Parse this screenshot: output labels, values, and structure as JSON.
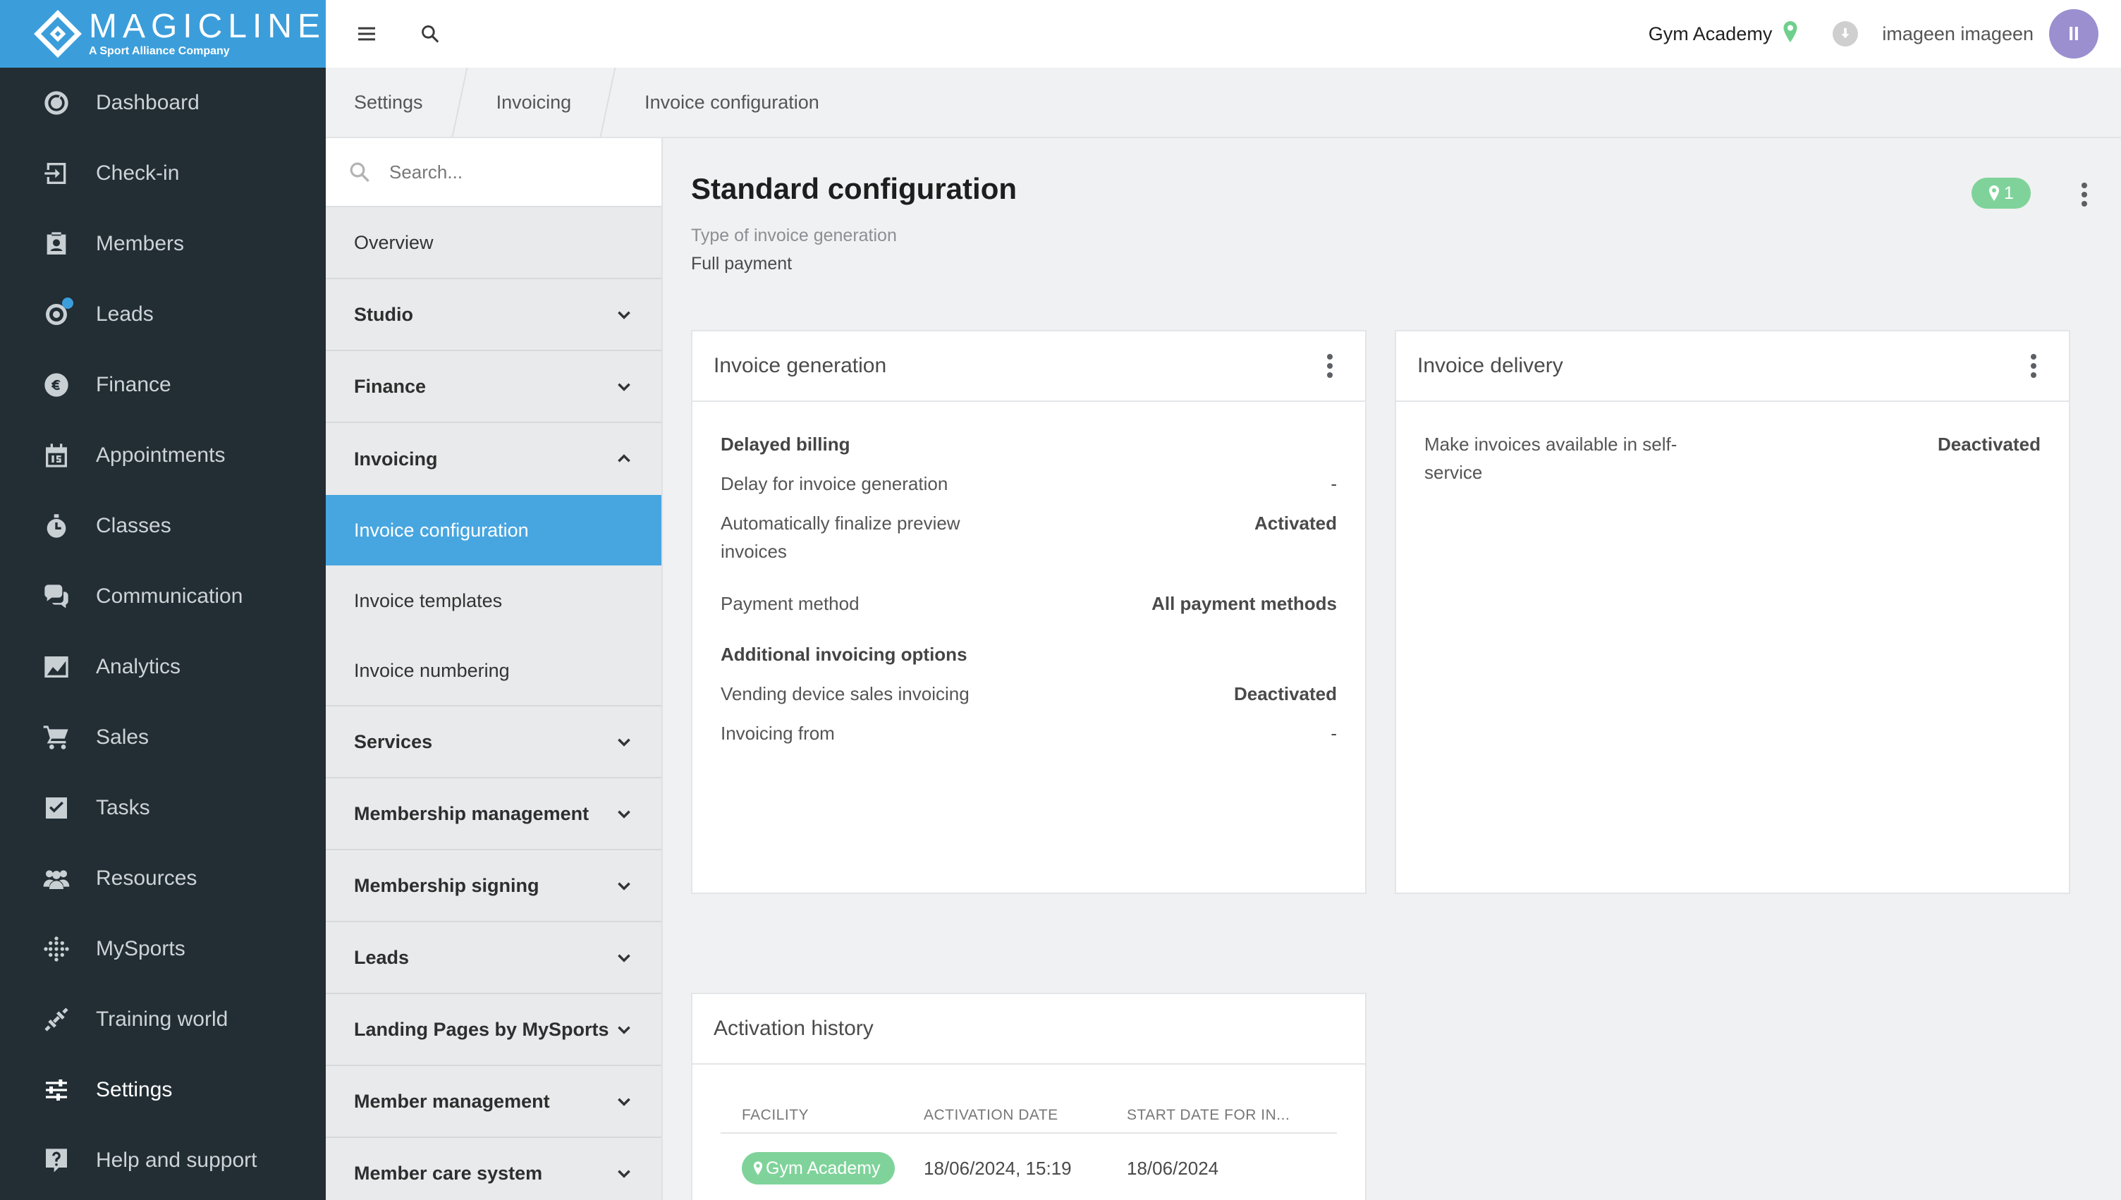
{
  "brand": {
    "name": "MAGICLINE",
    "tagline": "A Sport Alliance Company"
  },
  "nav": {
    "items": [
      {
        "label": "Dashboard",
        "icon": "dashboard-icon"
      },
      {
        "label": "Check-in",
        "icon": "check-in-icon"
      },
      {
        "label": "Members",
        "icon": "members-icon"
      },
      {
        "label": "Leads",
        "icon": "leads-icon"
      },
      {
        "label": "Finance",
        "icon": "euro-icon"
      },
      {
        "label": "Appointments",
        "icon": "calendar-icon"
      },
      {
        "label": "Classes",
        "icon": "stopwatch-icon"
      },
      {
        "label": "Communication",
        "icon": "chat-icon"
      },
      {
        "label": "Analytics",
        "icon": "chart-icon"
      },
      {
        "label": "Sales",
        "icon": "cart-icon"
      },
      {
        "label": "Tasks",
        "icon": "checkbox-icon"
      },
      {
        "label": "Resources",
        "icon": "people-icon"
      },
      {
        "label": "MySports",
        "icon": "dots-grid-icon"
      },
      {
        "label": "Training world",
        "icon": "dumbbell-icon"
      },
      {
        "label": "Settings",
        "icon": "sliders-icon"
      },
      {
        "label": "Help and support",
        "icon": "help-icon"
      }
    ]
  },
  "topbar": {
    "studio": "Gym Academy",
    "user": "imageen imageen",
    "avatar_initials": "II"
  },
  "breadcrumb": [
    "Settings",
    "Invoicing",
    "Invoice configuration"
  ],
  "subnav": {
    "search_placeholder": "Search...",
    "overview": "Overview",
    "studio": "Studio",
    "finance": "Finance",
    "invoicing": "Invoicing",
    "invoice_configuration": "Invoice configuration",
    "invoice_templates": "Invoice templates",
    "invoice_numbering": "Invoice numbering",
    "services": "Services",
    "membership_management": "Membership management",
    "membership_signing": "Membership signing",
    "leads": "Leads",
    "landing_pages": "Landing Pages by MySports",
    "member_management": "Member management",
    "member_care_system": "Member care system"
  },
  "main": {
    "title": "Standard configuration",
    "location_count": "1",
    "gen_type_label": "Type of invoice generation",
    "gen_type_value": "Full payment"
  },
  "invoice_generation": {
    "title": "Invoice generation",
    "delayed_billing": "Delayed billing",
    "delay_label": "Delay for invoice generation",
    "delay_value": "-",
    "auto_finalize_label": "Automatically finalize preview invoices",
    "auto_finalize_value": "Activated",
    "payment_method_label": "Payment method",
    "payment_method_value": "All payment methods",
    "additional_options": "Additional invoicing options",
    "vending_label": "Vending device sales invoicing",
    "vending_value": "Deactivated",
    "invoicing_from_label": "Invoicing from",
    "invoicing_from_value": "-"
  },
  "invoice_delivery": {
    "title": "Invoice delivery",
    "self_service_label": "Make invoices available in self-service",
    "self_service_value": "Deactivated"
  },
  "activation_history": {
    "title": "Activation history",
    "columns": [
      "FACILITY",
      "ACTIVATION DATE",
      "START DATE FOR IN..."
    ],
    "rows": [
      {
        "facility": "Gym Academy",
        "activation_date": "18/06/2024, 15:19",
        "start_date": "18/06/2024"
      }
    ]
  },
  "colors": {
    "nav_bg": "#222d34",
    "brand_blue": "#3b9edb",
    "selected_blue": "#47a6e0",
    "location_green": "#7fd39a",
    "avatar_purple": "#9b8fd0"
  }
}
